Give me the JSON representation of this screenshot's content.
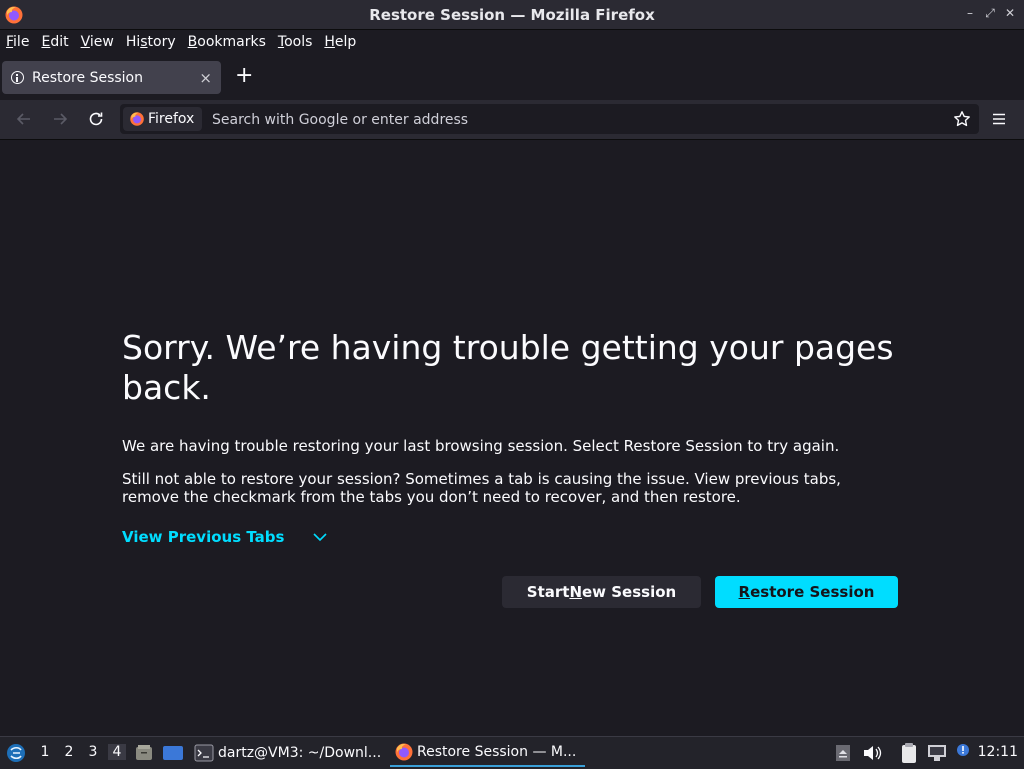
{
  "window": {
    "title": "Restore Session — Mozilla Firefox"
  },
  "menubar": {
    "items": [
      {
        "ul": "F",
        "rest": "ile"
      },
      {
        "ul": "E",
        "rest": "dit"
      },
      {
        "ul": "V",
        "rest": "iew"
      },
      {
        "pre": "Hi",
        "ul": "s",
        "rest": "tory"
      },
      {
        "ul": "B",
        "rest": "ookmarks"
      },
      {
        "ul": "T",
        "rest": "ools"
      },
      {
        "ul": "H",
        "rest": "elp"
      }
    ]
  },
  "tabs": [
    {
      "label": "Restore Session",
      "close": "×"
    }
  ],
  "newtab": "+",
  "urlbar": {
    "identity_label": "Firefox",
    "placeholder": "Search with Google or enter address"
  },
  "content": {
    "heading": "Sorry. We’re having trouble getting your pages back.",
    "p1": "We are having trouble restoring your last browsing session. Select Restore Session to try again.",
    "p2": "Still not able to restore your session? Sometimes a tab is causing the issue. View previous tabs, remove the checkmark from the tabs you don’t need to recover, and then restore.",
    "view_previous": "View Previous Tabs",
    "start_new": {
      "pre": "Start ",
      "ul": "N",
      "rest": "ew Session"
    },
    "restore": {
      "pre": "",
      "ul": "R",
      "rest": "estore Session"
    }
  },
  "taskbar": {
    "workspaces": [
      "1",
      "2",
      "3",
      "4"
    ],
    "active_workspace": "4",
    "tasks": [
      {
        "label": "dartz@VM3: ~/Downl..."
      },
      {
        "label": "Restore Session — M..."
      }
    ],
    "clock": "12:11"
  },
  "colors": {
    "accent": "#00ddff",
    "background": "#1c1b22",
    "toolbar": "#2b2a33"
  }
}
